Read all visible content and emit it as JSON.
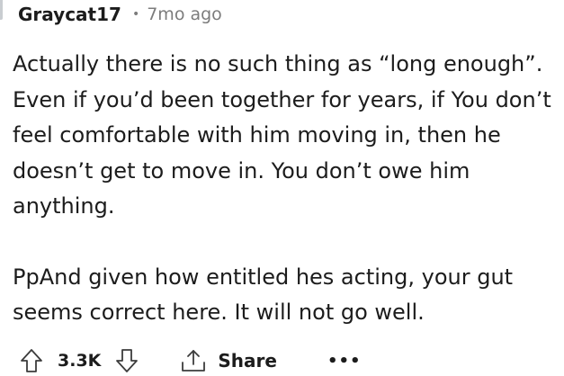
{
  "comment": {
    "username": "Graycat17",
    "separator": "•",
    "timestamp": "7mo ago",
    "paragraphs": [
      "Actually there is no such thing as “long enough”.\nEven if you’d been together for years, if You don’t\nfeel comfortable with him moving in, then he\ndoesn’t get to move in. You don’t owe him\nanything.",
      "PpAnd given how entitled hes acting, your gut\nseems correct here. It will not go well."
    ]
  },
  "actions": {
    "upvote_icon": "upvote-arrow-icon",
    "vote_count": "3.3K",
    "downvote_icon": "downvote-arrow-icon",
    "share_icon": "share-icon",
    "share_label": "Share",
    "more_label": "•••"
  }
}
